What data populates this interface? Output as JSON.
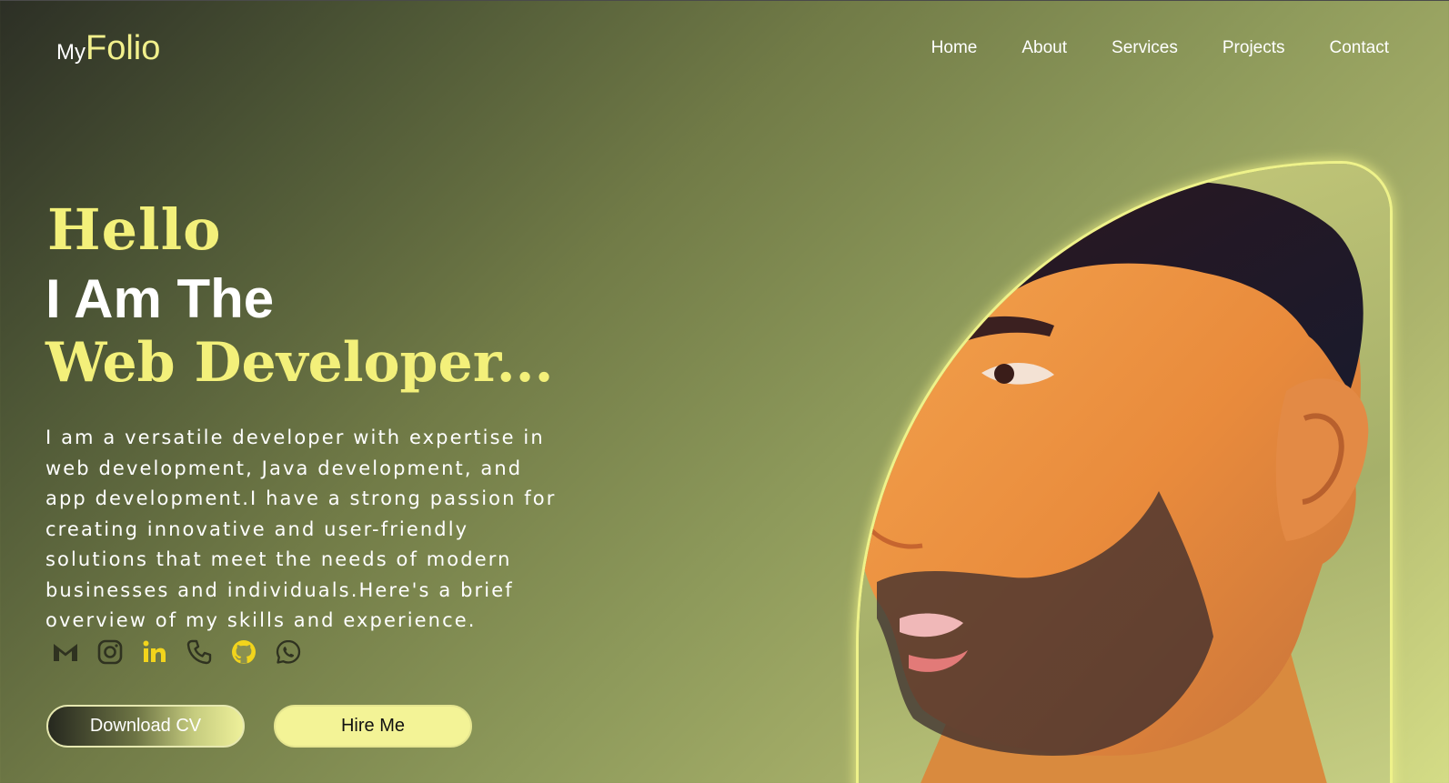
{
  "header": {
    "logo_prefix": "My",
    "logo_main": "Folio",
    "nav": [
      "Home",
      "About",
      "Services",
      "Projects",
      "Contact"
    ]
  },
  "hero": {
    "greeting": "Hello",
    "intro": "I Am The",
    "role": "Web Developer...",
    "description": "I am a versatile developer with expertise in web development, Java development, and app development.I have a strong passion for creating innovative and user-friendly solutions that meet the needs of modern businesses and individuals.Here's a brief overview of my skills and experience."
  },
  "socials": [
    {
      "icon": "gmail-icon",
      "color": "#2f3220"
    },
    {
      "icon": "instagram-icon",
      "color": "#2f3220"
    },
    {
      "icon": "linkedin-icon",
      "color": "#f2d41c"
    },
    {
      "icon": "phone-icon",
      "color": "#2f3220"
    },
    {
      "icon": "github-icon",
      "color": "#f2d41c"
    },
    {
      "icon": "whatsapp-icon",
      "color": "#2f3220"
    }
  ],
  "buttons": {
    "download_cv": "Download CV",
    "hire_me": "Hire Me"
  },
  "colors": {
    "accent": "#f3f07a",
    "button_light": "#f3f396"
  }
}
